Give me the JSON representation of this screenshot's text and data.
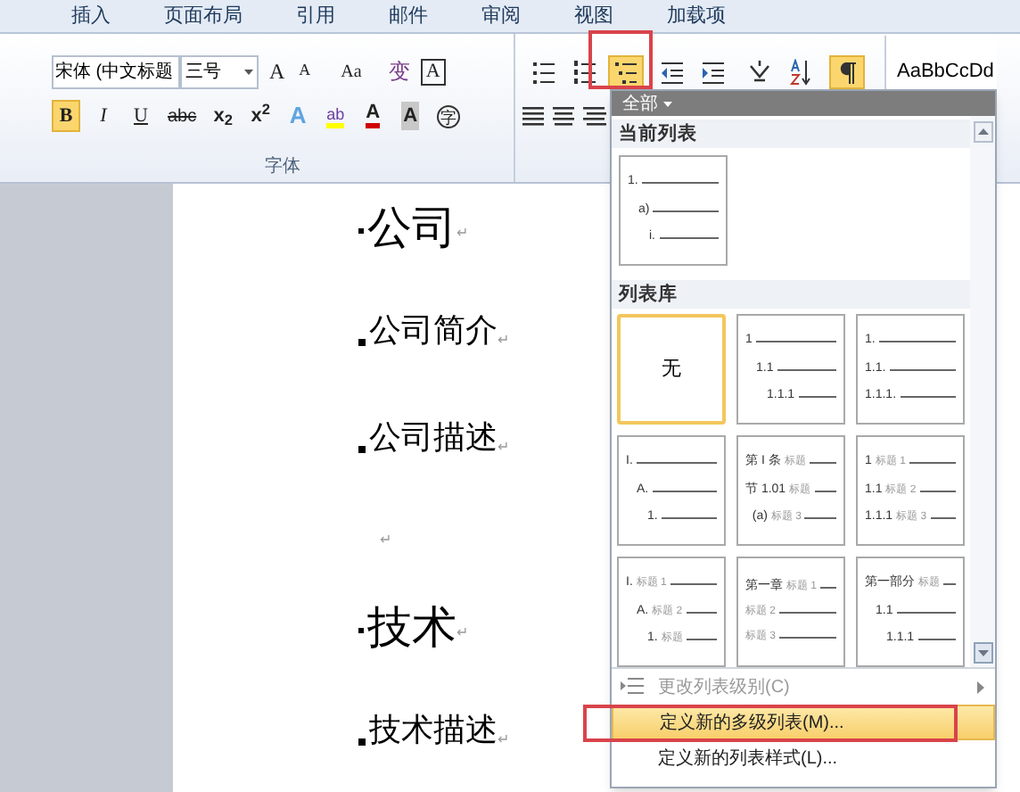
{
  "ribbon_tabs": [
    {
      "label": "插入",
      "selected": false
    },
    {
      "label": "页面布局",
      "selected": false
    },
    {
      "label": "引用",
      "selected": false
    },
    {
      "label": "邮件",
      "selected": false
    },
    {
      "label": "审阅",
      "selected": false
    },
    {
      "label": "视图",
      "selected": false
    },
    {
      "label": "加载项",
      "selected": false
    }
  ],
  "font_group": {
    "font_name": "宋体 (中文标题",
    "font_size": "三号",
    "label": "字体",
    "row1": [
      {
        "label": "A",
        "kind": "grow"
      },
      {
        "label": "A",
        "kind": "shrink"
      },
      {
        "label": "Aa",
        "kind": "case"
      },
      {
        "label": "变",
        "kind": "phonetic"
      },
      {
        "label": "A",
        "kind": "border"
      }
    ],
    "row2": [
      {
        "label": "B",
        "kind": "bold",
        "selected": true
      },
      {
        "label": "I",
        "kind": "italic",
        "selected": false
      },
      {
        "label": "U",
        "kind": "underline",
        "selected": false
      },
      {
        "label": "abc",
        "kind": "strike",
        "selected": false
      },
      {
        "label": "x$_{2}$",
        "kind": "sub",
        "selected": false
      },
      {
        "label": "x$^{2}$",
        "kind": "sup",
        "selected": false
      },
      {
        "label": "A",
        "kind": "effects",
        "selected": false
      },
      {
        "label": "ab",
        "kind": "highlight",
        "selected": false
      },
      {
        "label": "A",
        "kind": "color",
        "selected": false
      },
      {
        "label": "A",
        "kind": "shading",
        "selected": false
      },
      {
        "label": "字",
        "kind": "enclose",
        "selected": false
      }
    ]
  },
  "paragraph_tools": [
    {
      "kind": "bullets",
      "selected": false
    },
    {
      "kind": "numbering",
      "selected": false
    },
    {
      "kind": "multilevel",
      "selected": true
    },
    {
      "kind": "decrease-indent",
      "selected": false
    },
    {
      "kind": "increase-indent",
      "selected": false
    },
    {
      "kind": "asian-layout",
      "selected": false
    },
    {
      "kind": "sort",
      "selected": false
    },
    {
      "kind": "show-marks",
      "selected": true
    }
  ],
  "styles": {
    "sample": "AaBbCcDd"
  },
  "document": [
    {
      "kind": "heading",
      "text": "公司",
      "mark": "↵"
    },
    {
      "kind": "sub",
      "text": "公司简介",
      "mark": "↵"
    },
    {
      "kind": "sub",
      "text": "公司描述",
      "mark": "↵"
    },
    {
      "kind": "empty",
      "mark": "↵"
    },
    {
      "kind": "heading",
      "text": "技术",
      "mark": "↵"
    },
    {
      "kind": "sub",
      "text": "技术描述",
      "mark": "↵"
    }
  ],
  "dropdown": {
    "filter": "全部",
    "current_header": "当前列表",
    "current": [
      {
        "kind": "indented",
        "selected": false,
        "lines": [
          {
            "num": "1."
          },
          {
            "num": "a)"
          },
          {
            "num": "i."
          }
        ]
      }
    ],
    "library_header": "列表库",
    "library": [
      {
        "kind": "none",
        "selected": true,
        "label": "无"
      },
      {
        "kind": "indented",
        "selected": false,
        "lines": [
          {
            "num": "1"
          },
          {
            "num": "1.1"
          },
          {
            "num": "1.1.1"
          }
        ]
      },
      {
        "kind": "flat",
        "selected": false,
        "lines": [
          {
            "num": "1."
          },
          {
            "num": "1.1."
          },
          {
            "num": "1.1.1."
          }
        ]
      },
      {
        "kind": "indented",
        "selected": false,
        "lines": [
          {
            "num": "I."
          },
          {
            "num": "A."
          },
          {
            "num": "1."
          }
        ]
      },
      {
        "kind": "flat",
        "selected": false,
        "lines": [
          {
            "num": "第 I 条",
            "label": "标题"
          },
          {
            "num": "节 1.01",
            "label": "标题"
          },
          {
            "num": "  (a)",
            "label": "标题 3"
          }
        ]
      },
      {
        "kind": "flat",
        "selected": false,
        "lines": [
          {
            "num": "1",
            "label": "标题 1"
          },
          {
            "num": "1.1",
            "label": "标题 2"
          },
          {
            "num": "1.1.1",
            "label": "标题 3"
          }
        ]
      },
      {
        "kind": "indented",
        "selected": false,
        "lines": [
          {
            "num": "I.",
            "label": "标题 1"
          },
          {
            "num": "A.",
            "label": "标题 2"
          },
          {
            "num": "1.",
            "label": "标题"
          }
        ]
      },
      {
        "kind": "flat",
        "selected": false,
        "lines": [
          {
            "num": "第一章",
            "label": "标题 1"
          },
          {
            "label": "标题 2"
          },
          {
            "label": "标题 3"
          }
        ]
      },
      {
        "kind": "indented",
        "selected": false,
        "lines": [
          {
            "num": "第一部分",
            "label": "标题"
          },
          {
            "num": "1.1"
          },
          {
            "num": "1.1.1"
          }
        ]
      }
    ],
    "menu": [
      {
        "label": "更改列表级别(C)",
        "disabled": true,
        "selected": false,
        "submenu": true
      },
      {
        "label": "定义新的多级列表(M)...",
        "disabled": false,
        "selected": true,
        "submenu": false
      },
      {
        "label": "定义新的列表样式(L)...",
        "disabled": false,
        "selected": false,
        "submenu": false
      }
    ]
  }
}
